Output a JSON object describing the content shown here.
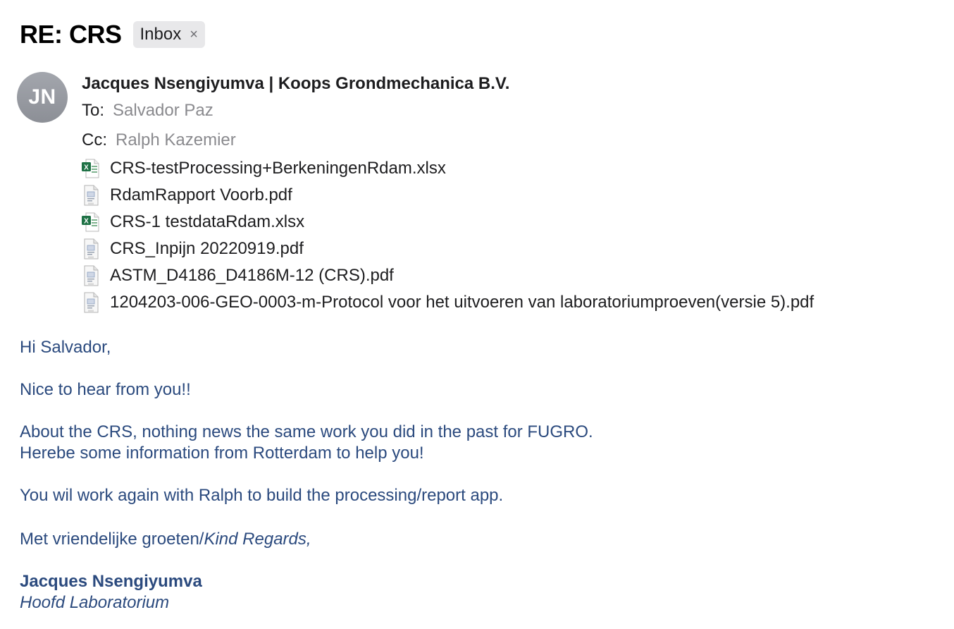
{
  "message": {
    "subject": "RE: CRS",
    "label": "Inbox",
    "label_close": "×"
  },
  "sender": {
    "avatar_initials": "JN",
    "name": "Jacques Nsengiyumva | Koops Grondmechanica B.V."
  },
  "recipients": {
    "to_label": "To:",
    "to": "Salvador Paz",
    "cc_label": "Cc:",
    "cc": "Ralph Kazemier"
  },
  "attachments": [
    {
      "name": "CRS-testProcessing+BerkeningenRdam.xlsx",
      "icon": "excel-icon"
    },
    {
      "name": "RdamRapport Voorb.pdf",
      "icon": "pdf-icon"
    },
    {
      "name": "CRS-1 testdataRdam.xlsx",
      "icon": "excel-icon"
    },
    {
      "name": "CRS_Inpijn 20220919.pdf",
      "icon": "pdf-icon"
    },
    {
      "name": "ASTM_D4186_D4186M-12 (CRS).pdf",
      "icon": "pdf-icon"
    },
    {
      "name": "1204203-006-GEO-0003-m-Protocol voor het uitvoeren van laboratoriumproeven(versie 5).pdf",
      "icon": "pdf-icon"
    }
  ],
  "body": {
    "greeting": "Hi Salvador,",
    "line1": "Nice to hear from you!!",
    "line2a": "About the CRS, nothing news the same work you did in the past for FUGRO.",
    "line2b": "Herebe some information from Rotterdam to help you!",
    "line3": "You wil work again with Ralph to build the processing/report app.",
    "closing_regular": "Met vriendelijke groeten/",
    "closing_italic": "Kind Regards,",
    "signature_name": "Jacques Nsengiyumva",
    "signature_title": "Hoofd Laboratorium"
  },
  "colors": {
    "body_text": "#2b4a7e",
    "recipient_value": "#8a8a8e",
    "chip_bg": "#e8e8ea",
    "excel_green": "#1e7145"
  }
}
